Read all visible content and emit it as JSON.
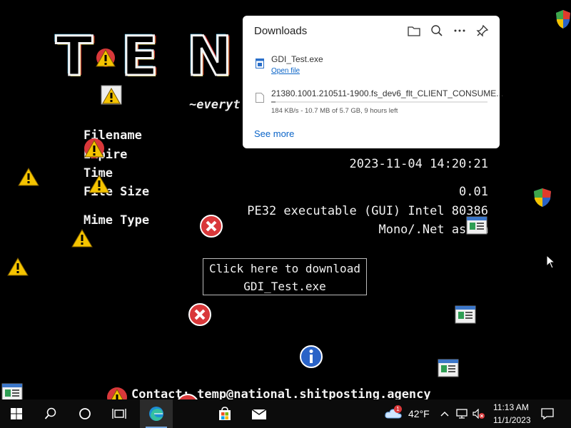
{
  "page": {
    "title_partial": "TEN  H",
    "tagline_partial": "~everyt",
    "labels": {
      "filename": "Filename",
      "expire": "Expire",
      "time": "Time",
      "file_size": "File Size",
      "mime_type": "Mime Type"
    },
    "values": {
      "time": "2023-11-04 14:20:21",
      "file_size": "0.01",
      "mime_line1": "PE32 executable (GUI) Intel 80386",
      "mime_line2": "Mono/.Net assem"
    },
    "download_button": {
      "line1": "Click here to download",
      "line2": "GDI_Test.exe"
    },
    "contact": "Contact: temp@national.shitposting.agency"
  },
  "downloads_panel": {
    "title": "Downloads",
    "icons": [
      "folder-icon",
      "search-icon",
      "more-icon",
      "pin-icon"
    ],
    "items": [
      {
        "name": "GDI_Test.exe",
        "action": "Open file"
      },
      {
        "name": "21380.1001.210511-1900.fs_dev6_flt_CLIENT_CONSUME...",
        "status": "184 KB/s - 10.7 MB of 5.7 GB, 9 hours left",
        "progress": 0.02
      }
    ],
    "see_more": "See more"
  },
  "taskbar": {
    "weather_temp": "42°F",
    "weather_badge": "1",
    "time": "11:13 AM",
    "date": "11/1/2023"
  },
  "colors": {
    "background": "#000000",
    "taskbar": "#0c0c0c",
    "link": "#0a64c8",
    "warning": "#f5c400",
    "error": "#d9383a",
    "info": "#2a63c7"
  }
}
